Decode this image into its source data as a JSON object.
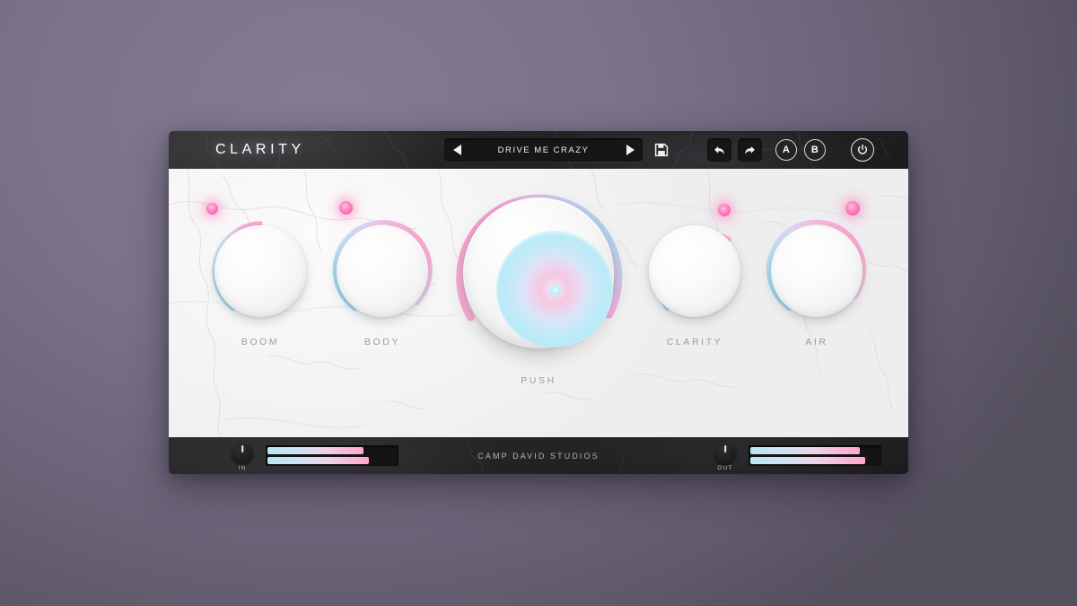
{
  "app": {
    "brand": "CLARITY",
    "footer": "CAMP DAVID STUDIOS"
  },
  "header": {
    "preset": {
      "name": "DRIVE ME CRAZY",
      "prev_icon": "triangle-left-icon",
      "next_icon": "triangle-right-icon",
      "save_icon": "floppy-disk-icon"
    },
    "buttons": {
      "undo_icon": "undo-arrow-icon",
      "redo_icon": "redo-arrow-icon",
      "a_label": "A",
      "b_label": "B",
      "power_icon": "power-icon"
    }
  },
  "knobs": [
    {
      "id": "boom",
      "label": "BOOM",
      "value_pct": 38,
      "led_side": "left"
    },
    {
      "id": "body",
      "label": "BODY",
      "value_pct": 72,
      "led_side": "left"
    },
    {
      "id": "push",
      "label": "PUSH",
      "value_pct": 78,
      "led_side": "none"
    },
    {
      "id": "clarity",
      "label": "CLARITY",
      "value_pct": 44,
      "led_side": "right"
    },
    {
      "id": "air",
      "label": "AIR",
      "value_pct": 80,
      "led_side": "right"
    }
  ],
  "meters": {
    "input": {
      "label": "IN",
      "bar_top_pct": 74,
      "bar_bottom_pct": 78
    },
    "output": {
      "label": "OUT",
      "bar_top_pct": 84,
      "bar_bottom_pct": 88
    }
  },
  "colors": {
    "accent_pink": "#ff9ecd",
    "accent_cyan": "#9fdff4",
    "panel_dark": "#232325",
    "panel_light": "#f4f4f4",
    "backdrop": "#7a7388",
    "label_grey": "#9b9b9f"
  }
}
